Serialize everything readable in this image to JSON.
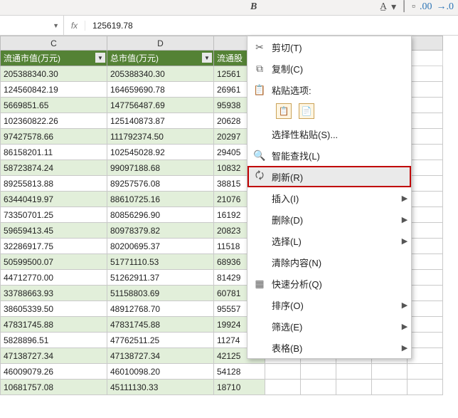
{
  "toolbar": {
    "bold_label": "B"
  },
  "formula": {
    "fx": "fx",
    "value": "125619.78"
  },
  "columns": [
    "C",
    "D",
    "",
    "",
    "",
    "",
    "",
    ""
  ],
  "headers": {
    "c": "流通市值(万元)",
    "d": "总市值(万元)",
    "e": "流通股"
  },
  "rows": [
    {
      "c": "205388340.30",
      "d": "205388340.30",
      "e": "12561"
    },
    {
      "c": "124560842.19",
      "d": "164659690.78",
      "e": "26961"
    },
    {
      "c": "5669851.65",
      "d": "147756487.69",
      "e": "95938"
    },
    {
      "c": "102360822.26",
      "d": "125140873.87",
      "e": "20628"
    },
    {
      "c": "97427578.66",
      "d": "111792374.50",
      "e": "20297"
    },
    {
      "c": "86158201.11",
      "d": "102545028.92",
      "e": "29405"
    },
    {
      "c": "58723874.24",
      "d": "99097188.68",
      "e": "10832"
    },
    {
      "c": "89255813.88",
      "d": "89257576.08",
      "e": "38815"
    },
    {
      "c": "63440419.97",
      "d": "88610725.16",
      "e": "21076"
    },
    {
      "c": "73350701.25",
      "d": "80856296.90",
      "e": "16192"
    },
    {
      "c": "59659413.45",
      "d": "80978379.82",
      "e": "20823"
    },
    {
      "c": "32286917.75",
      "d": "80200695.37",
      "e": "11518"
    },
    {
      "c": "50599500.07",
      "d": "51771110.53",
      "e": "68936"
    },
    {
      "c": "44712770.00",
      "d": "51262911.37",
      "e": "81429"
    },
    {
      "c": "33788663.93",
      "d": "51158803.69",
      "e": "60781"
    },
    {
      "c": "38605339.50",
      "d": "48912768.70",
      "e": "95557"
    },
    {
      "c": "47831745.88",
      "d": "47831745.88",
      "e": "19924"
    },
    {
      "c": "5828896.51",
      "d": "47762511.25",
      "e": "11274"
    },
    {
      "c": "47138727.34",
      "d": "47138727.34",
      "e": "42125"
    },
    {
      "c": "46009079.26",
      "d": "46010098.20",
      "e": "54128"
    },
    {
      "c": "10681757.08",
      "d": "45111130.33",
      "e": "18710"
    }
  ],
  "context_menu": {
    "cut": {
      "label": "剪切(T)"
    },
    "copy": {
      "label": "复制(C)"
    },
    "paste_hdr": {
      "label": "粘贴选项:"
    },
    "paste_spec": {
      "label": "选择性粘贴(S)..."
    },
    "smart": {
      "label": "智能查找(L)"
    },
    "refresh": {
      "label": "刷新(R)"
    },
    "insert": {
      "label": "插入(I)"
    },
    "delete": {
      "label": "删除(D)"
    },
    "select": {
      "label": "选择(L)"
    },
    "clear": {
      "label": "清除内容(N)"
    },
    "quick": {
      "label": "快速分析(Q)"
    },
    "sort": {
      "label": "排序(O)"
    },
    "filter": {
      "label": "筛选(E)"
    },
    "table": {
      "label": "表格(B)"
    }
  }
}
